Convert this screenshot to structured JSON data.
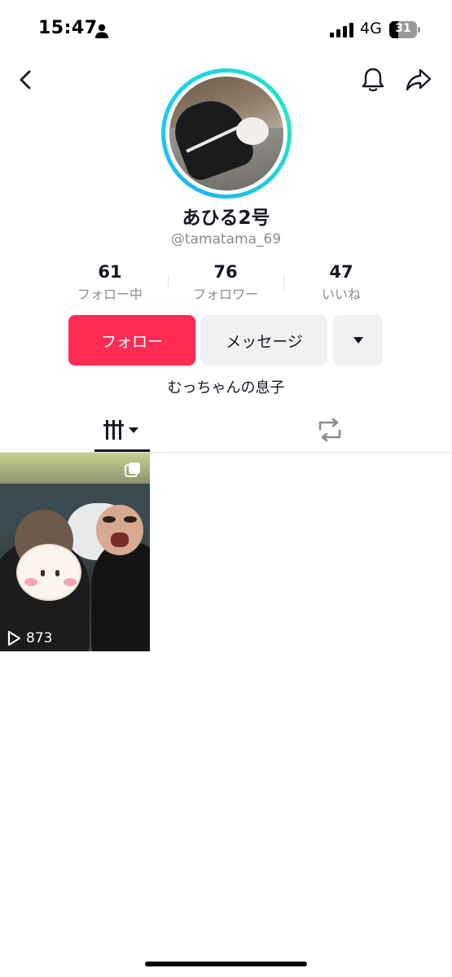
{
  "status_bar": {
    "time": "15:47",
    "network": "4G",
    "battery": "31",
    "battery_level": 0.31,
    "icons": [
      "person-icon",
      "signal-icon",
      "battery-icon"
    ]
  },
  "nav": {
    "icons": [
      "back-icon",
      "bell-icon",
      "share-icon"
    ]
  },
  "profile": {
    "display_name": "あひる2号",
    "username": "@tamatama_69",
    "bio": "むっちゃんの息子",
    "avatar_ring_colors": [
      "#1fb5f5",
      "#22e6c4"
    ]
  },
  "stats": [
    {
      "value": "61",
      "label": "フォロー中"
    },
    {
      "value": "76",
      "label": "フォロワー"
    },
    {
      "value": "47",
      "label": "いいね"
    }
  ],
  "actions": {
    "follow_label": "フォロー",
    "message_label": "メッセージ",
    "more_icon": "caret-down-icon",
    "follow_color": "#fe2c55"
  },
  "tabs": [
    {
      "icon": "videos-grid-icon",
      "active": true
    },
    {
      "icon": "repost-icon",
      "active": false
    }
  ],
  "videos": [
    {
      "views": "873",
      "multi_icon": "photo-stack-icon",
      "play_icon": "play-icon"
    }
  ]
}
